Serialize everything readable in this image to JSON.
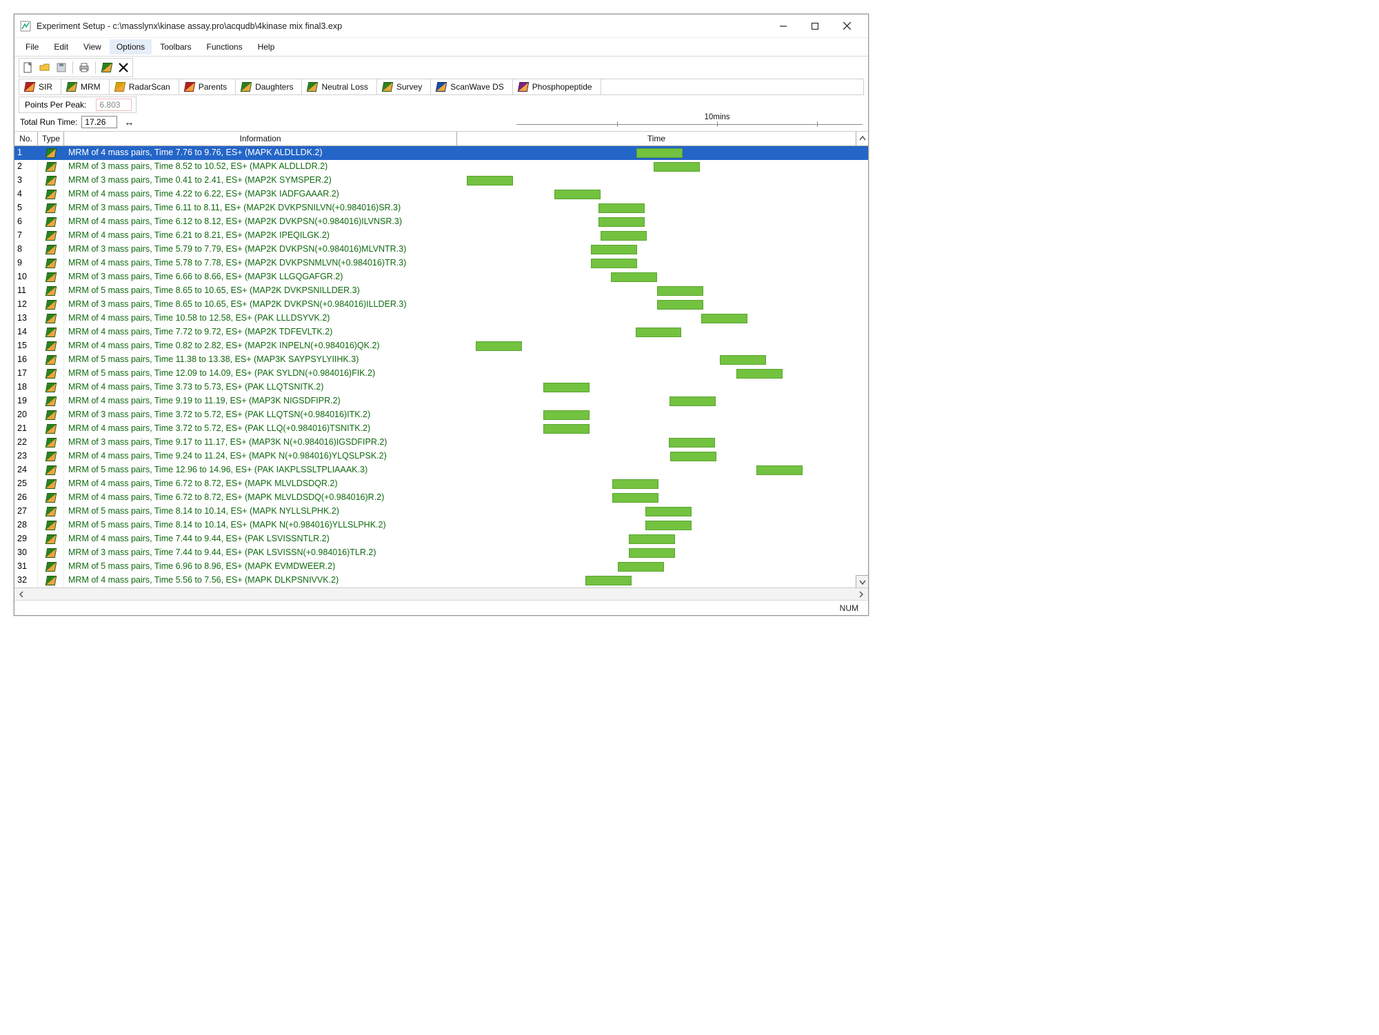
{
  "window": {
    "title": "Experiment Setup - c:\\masslynx\\kinase assay.pro\\acqudb\\4kinase mix final3.exp"
  },
  "menubar": [
    "File",
    "Edit",
    "View",
    "Options",
    "Toolbars",
    "Functions",
    "Help"
  ],
  "menu_active_index": 3,
  "type_tabs": [
    {
      "label": "SIR",
      "icon": "red"
    },
    {
      "label": "MRM",
      "icon": "green"
    },
    {
      "label": "RadarScan",
      "icon": "gold"
    },
    {
      "label": "Parents",
      "icon": "red"
    },
    {
      "label": "Daughters",
      "icon": "green"
    },
    {
      "label": "Neutral Loss",
      "icon": "green"
    },
    {
      "label": "Survey",
      "icon": "green"
    },
    {
      "label": "ScanWave DS",
      "icon": "blue"
    },
    {
      "label": "Phosphopeptide",
      "icon": "purple"
    }
  ],
  "points_per_peak": {
    "label": "Points Per Peak:",
    "value": "6.803"
  },
  "total_run_time": {
    "label": "Total Run Time:",
    "value": "17.26"
  },
  "ruler_label": "10mins",
  "time_axis": {
    "min": 0,
    "max": 17.26
  },
  "columns": {
    "no": "No.",
    "type": "Type",
    "info": "Information",
    "time": "Time"
  },
  "statusbar": {
    "num": "NUM"
  },
  "rows": [
    {
      "no": 1,
      "selected": true,
      "info": "MRM of 4 mass pairs, Time 7.76 to 9.76, ES+ (MAPK ALDLLDK.2)",
      "start": 7.76,
      "end": 9.76
    },
    {
      "no": 2,
      "info": "MRM of 3 mass pairs, Time 8.52 to 10.52, ES+ (MAPK ALDLLDR.2)",
      "start": 8.52,
      "end": 10.52
    },
    {
      "no": 3,
      "info": "MRM of 3 mass pairs, Time 0.41 to 2.41, ES+ (MAP2K SYMSPER.2)",
      "start": 0.41,
      "end": 2.41
    },
    {
      "no": 4,
      "info": "MRM of 4 mass pairs, Time 4.22 to 6.22, ES+ (MAP3K IADFGAAAR.2)",
      "start": 4.22,
      "end": 6.22
    },
    {
      "no": 5,
      "info": "MRM of 3 mass pairs, Time 6.11 to 8.11, ES+ (MAP2K DVKPSNILVN(+0.984016)SR.3)",
      "start": 6.11,
      "end": 8.11
    },
    {
      "no": 6,
      "info": "MRM of 4 mass pairs, Time 6.12 to 8.12, ES+ (MAP2K DVKPSN(+0.984016)ILVNSR.3)",
      "start": 6.12,
      "end": 8.12
    },
    {
      "no": 7,
      "info": "MRM of 4 mass pairs, Time 6.21 to 8.21, ES+ (MAP2K IPEQILGK.2)",
      "start": 6.21,
      "end": 8.21
    },
    {
      "no": 8,
      "info": "MRM of 3 mass pairs, Time 5.79 to 7.79, ES+ (MAP2K DVKPSN(+0.984016)MLVNTR.3)",
      "start": 5.79,
      "end": 7.79
    },
    {
      "no": 9,
      "info": "MRM of 4 mass pairs, Time 5.78 to 7.78, ES+ (MAP2K DVKPSNMLVN(+0.984016)TR.3)",
      "start": 5.78,
      "end": 7.78
    },
    {
      "no": 10,
      "info": "MRM of 3 mass pairs, Time 6.66 to 8.66, ES+ (MAP3K LLGQGAFGR.2)",
      "start": 6.66,
      "end": 8.66
    },
    {
      "no": 11,
      "info": "MRM of 5 mass pairs, Time 8.65 to 10.65, ES+ (MAP2K DVKPSNILLDER.3)",
      "start": 8.65,
      "end": 10.65
    },
    {
      "no": 12,
      "info": "MRM of 3 mass pairs, Time 8.65 to 10.65, ES+ (MAP2K DVKPSN(+0.984016)ILLDER.3)",
      "start": 8.65,
      "end": 10.65
    },
    {
      "no": 13,
      "info": "MRM of 4 mass pairs, Time 10.58 to 12.58, ES+ (PAK LLLDSYVK.2)",
      "start": 10.58,
      "end": 12.58
    },
    {
      "no": 14,
      "info": "MRM of 4 mass pairs, Time 7.72 to 9.72, ES+ (MAP2K TDFEVLTK.2)",
      "start": 7.72,
      "end": 9.72
    },
    {
      "no": 15,
      "info": "MRM of 4 mass pairs, Time 0.82 to 2.82, ES+ (MAP2K INPELN(+0.984016)QK.2)",
      "start": 0.82,
      "end": 2.82
    },
    {
      "no": 16,
      "info": "MRM of 5 mass pairs, Time 11.38 to 13.38, ES+ (MAP3K SAYPSYLYIIHK.3)",
      "start": 11.38,
      "end": 13.38
    },
    {
      "no": 17,
      "info": "MRM of 5 mass pairs, Time 12.09 to 14.09, ES+ (PAK SYLDN(+0.984016)FIK.2)",
      "start": 12.09,
      "end": 14.09
    },
    {
      "no": 18,
      "info": "MRM of 4 mass pairs, Time 3.73 to 5.73, ES+ (PAK LLQTSNITK.2)",
      "start": 3.73,
      "end": 5.73
    },
    {
      "no": 19,
      "info": "MRM of 4 mass pairs, Time 9.19 to 11.19, ES+ (MAP3K NIGSDFIPR.2)",
      "start": 9.19,
      "end": 11.19
    },
    {
      "no": 20,
      "info": "MRM of 3 mass pairs, Time 3.72 to 5.72, ES+ (PAK LLQTSN(+0.984016)ITK.2)",
      "start": 3.72,
      "end": 5.72
    },
    {
      "no": 21,
      "info": "MRM of 4 mass pairs, Time 3.72 to 5.72, ES+ (PAK LLQ(+0.984016)TSNITK.2)",
      "start": 3.72,
      "end": 5.72
    },
    {
      "no": 22,
      "info": "MRM of 3 mass pairs, Time 9.17 to 11.17, ES+ (MAP3K N(+0.984016)IGSDFIPR.2)",
      "start": 9.17,
      "end": 11.17
    },
    {
      "no": 23,
      "info": "MRM of 4 mass pairs, Time 9.24 to 11.24, ES+ (MAPK N(+0.984016)YLQSLPSK.2)",
      "start": 9.24,
      "end": 11.24
    },
    {
      "no": 24,
      "info": "MRM of 5 mass pairs, Time 12.96 to 14.96, ES+ (PAK IAKPLSSLTPLIAAAK.3)",
      "start": 12.96,
      "end": 14.96
    },
    {
      "no": 25,
      "info": "MRM of 4 mass pairs, Time 6.72 to 8.72, ES+ (MAPK MLVLDSDQR.2)",
      "start": 6.72,
      "end": 8.72
    },
    {
      "no": 26,
      "info": "MRM of 4 mass pairs, Time 6.72 to 8.72, ES+ (MAPK MLVLDSDQ(+0.984016)R.2)",
      "start": 6.72,
      "end": 8.72
    },
    {
      "no": 27,
      "info": "MRM of 5 mass pairs, Time 8.14 to 10.14, ES+ (MAPK NYLLSLPHK.2)",
      "start": 8.14,
      "end": 10.14
    },
    {
      "no": 28,
      "info": "MRM of 5 mass pairs, Time 8.14 to 10.14, ES+ (MAPK N(+0.984016)YLLSLPHK.2)",
      "start": 8.14,
      "end": 10.14
    },
    {
      "no": 29,
      "info": "MRM of 4 mass pairs, Time 7.44 to 9.44, ES+ (PAK LSVISSNTLR.2)",
      "start": 7.44,
      "end": 9.44
    },
    {
      "no": 30,
      "info": "MRM of 3 mass pairs, Time 7.44 to 9.44, ES+ (PAK LSVISSN(+0.984016)TLR.2)",
      "start": 7.44,
      "end": 9.44
    },
    {
      "no": 31,
      "info": "MRM of 5 mass pairs, Time 6.96 to 8.96, ES+ (MAPK EVMDWEER.2)",
      "start": 6.96,
      "end": 8.96
    },
    {
      "no": 32,
      "info": "MRM of 4 mass pairs, Time 5.56 to 7.56, ES+ (MAPK DLKPSNIVVK.2)",
      "start": 5.56,
      "end": 7.56
    }
  ]
}
